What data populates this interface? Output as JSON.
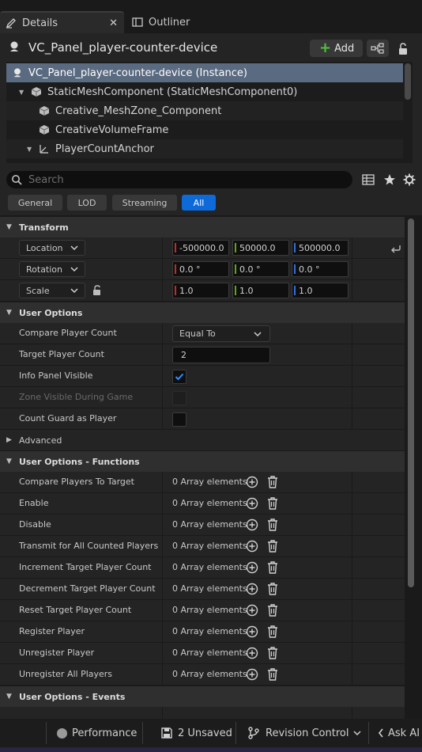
{
  "tabs": {
    "details": "Details",
    "outliner": "Outliner"
  },
  "header": {
    "actor_name": "VC_Panel_player-counter-device",
    "add_label": "Add"
  },
  "tree": {
    "items": [
      "VC_Panel_player-counter-device (Instance)",
      "StaticMeshComponent (StaticMeshComponent0)",
      "Creative_MeshZone_Component",
      "CreativeVolumeFrame",
      "PlayerCountAnchor"
    ]
  },
  "search": {
    "placeholder": "Search"
  },
  "filters": [
    "General",
    "LOD",
    "Streaming",
    "All"
  ],
  "transform": {
    "title": "Transform",
    "location_label": "Location",
    "rotation_label": "Rotation",
    "scale_label": "Scale",
    "location": [
      "-500000.0",
      "50000.0",
      "500000.0"
    ],
    "rotation": [
      "0.0 °",
      "0.0 °",
      "0.0 °"
    ],
    "scale": [
      "1.0",
      "1.0",
      "1.0"
    ]
  },
  "user_options": {
    "title": "User Options",
    "compare_label": "Compare Player Count",
    "compare_value": "Equal To",
    "target_label": "Target Player Count",
    "target_value": "2",
    "info_label": "Info Panel Visible",
    "zone_label": "Zone Visible During Game",
    "guard_label": "Count Guard as Player",
    "advanced_label": "Advanced"
  },
  "functions": {
    "title": "User Options - Functions",
    "array_text": "0 Array elements",
    "items": [
      "Compare Players To Target",
      "Enable",
      "Disable",
      "Transmit for All Counted Players",
      "Increment Target Player Count",
      "Decrement Target Player Count",
      "Reset Target Player Count",
      "Register Player",
      "Unregister Player",
      "Unregister All Players"
    ]
  },
  "events": {
    "title": "User Options - Events"
  },
  "statusbar": {
    "performance": "Performance",
    "unsaved": "2 Unsaved",
    "revision": "Revision Control",
    "ask_ai": "Ask AI"
  },
  "colors": {
    "accent": "#0e6ad8",
    "x_axis": "#c42a2a",
    "y_axis": "#5fa516",
    "z_axis": "#2f6fd8",
    "add_plus": "#4fc33c"
  }
}
